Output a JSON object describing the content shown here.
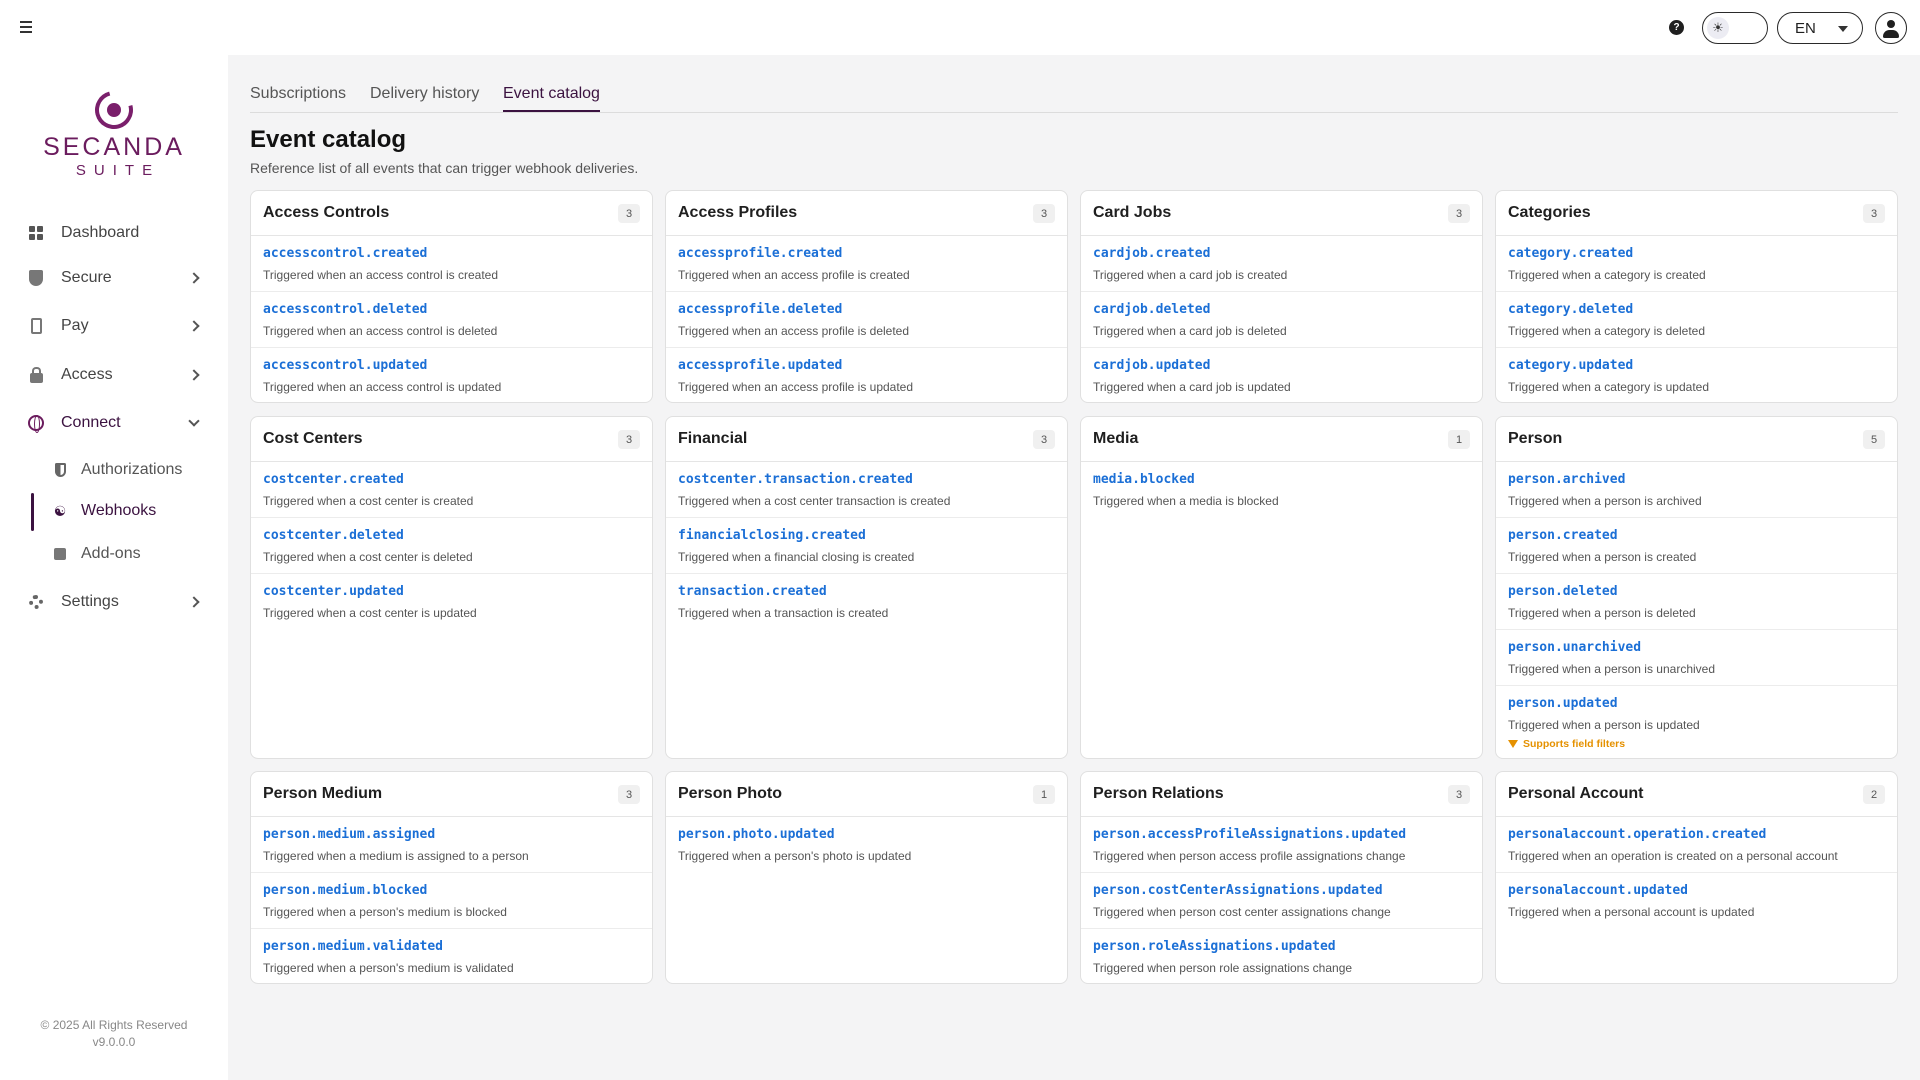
{
  "topbar": {
    "help_glyph": "?",
    "theme_glyph": "☀",
    "language": "EN"
  },
  "brand": {
    "name": "SECANDA",
    "suite": "SUITE",
    "color": "#6b1c5e"
  },
  "sidebar": {
    "items": [
      {
        "label": "Dashboard"
      },
      {
        "label": "Secure"
      },
      {
        "label": "Pay"
      },
      {
        "label": "Access"
      },
      {
        "label": "Connect"
      },
      {
        "label": "Settings"
      }
    ],
    "connect_sub": [
      {
        "label": "Authorizations"
      },
      {
        "label": "Webhooks"
      },
      {
        "label": "Add-ons"
      }
    ],
    "footer_copyright": "© 2025 All Rights Reserved",
    "footer_version": "v9.0.0.0"
  },
  "tabs": [
    {
      "label": "Subscriptions"
    },
    {
      "label": "Delivery history"
    },
    {
      "label": "Event catalog"
    }
  ],
  "page": {
    "title": "Event catalog",
    "subtitle": "Reference list of all events that can trigger webhook deliveries."
  },
  "colors": {
    "event_name": "#1b6fd6",
    "filter_note": "#e59100",
    "accent": "#3b1240"
  },
  "cards": [
    {
      "title": "Access Controls",
      "count": "3",
      "events": [
        {
          "name": "accesscontrol.created",
          "desc": "Triggered when an access control is created"
        },
        {
          "name": "accesscontrol.deleted",
          "desc": "Triggered when an access control is deleted"
        },
        {
          "name": "accesscontrol.updated",
          "desc": "Triggered when an access control is updated"
        }
      ]
    },
    {
      "title": "Access Profiles",
      "count": "3",
      "events": [
        {
          "name": "accessprofile.created",
          "desc": "Triggered when an access profile is created"
        },
        {
          "name": "accessprofile.deleted",
          "desc": "Triggered when an access profile is deleted"
        },
        {
          "name": "accessprofile.updated",
          "desc": "Triggered when an access profile is updated"
        }
      ]
    },
    {
      "title": "Card Jobs",
      "count": "3",
      "events": [
        {
          "name": "cardjob.created",
          "desc": "Triggered when a card job is created"
        },
        {
          "name": "cardjob.deleted",
          "desc": "Triggered when a card job is deleted"
        },
        {
          "name": "cardjob.updated",
          "desc": "Triggered when a card job is updated"
        }
      ]
    },
    {
      "title": "Categories",
      "count": "3",
      "events": [
        {
          "name": "category.created",
          "desc": "Triggered when a category is created"
        },
        {
          "name": "category.deleted",
          "desc": "Triggered when a category is deleted"
        },
        {
          "name": "category.updated",
          "desc": "Triggered when a category is updated"
        }
      ]
    },
    {
      "title": "Cost Centers",
      "count": "3",
      "events": [
        {
          "name": "costcenter.created",
          "desc": "Triggered when a cost center is created"
        },
        {
          "name": "costcenter.deleted",
          "desc": "Triggered when a cost center is deleted"
        },
        {
          "name": "costcenter.updated",
          "desc": "Triggered when a cost center is updated"
        }
      ]
    },
    {
      "title": "Financial",
      "count": "3",
      "events": [
        {
          "name": "costcenter.transaction.created",
          "desc": "Triggered when a cost center transaction is created"
        },
        {
          "name": "financialclosing.created",
          "desc": "Triggered when a financial closing is created"
        },
        {
          "name": "transaction.created",
          "desc": "Triggered when a transaction is created"
        }
      ]
    },
    {
      "title": "Media",
      "count": "1",
      "events": [
        {
          "name": "media.blocked",
          "desc": "Triggered when a media is blocked"
        }
      ]
    },
    {
      "title": "Person",
      "count": "5",
      "events": [
        {
          "name": "person.archived",
          "desc": "Triggered when a person is archived"
        },
        {
          "name": "person.created",
          "desc": "Triggered when a person is created"
        },
        {
          "name": "person.deleted",
          "desc": "Triggered when a person is deleted"
        },
        {
          "name": "person.unarchived",
          "desc": "Triggered when a person is unarchived"
        },
        {
          "name": "person.updated",
          "desc": "Triggered when a person is updated",
          "filter": "Supports field filters"
        }
      ]
    },
    {
      "title": "Person Medium",
      "count": "3",
      "events": [
        {
          "name": "person.medium.assigned",
          "desc": "Triggered when a medium is assigned to a person"
        },
        {
          "name": "person.medium.blocked",
          "desc": "Triggered when a person's medium is blocked"
        },
        {
          "name": "person.medium.validated",
          "desc": "Triggered when a person's medium is validated"
        }
      ]
    },
    {
      "title": "Person Photo",
      "count": "1",
      "events": [
        {
          "name": "person.photo.updated",
          "desc": "Triggered when a person's photo is updated"
        }
      ]
    },
    {
      "title": "Person Relations",
      "count": "3",
      "events": [
        {
          "name": "person.accessProfileAssignations.updated",
          "desc": "Triggered when person access profile assignations change"
        },
        {
          "name": "person.costCenterAssignations.updated",
          "desc": "Triggered when person cost center assignations change"
        },
        {
          "name": "person.roleAssignations.updated",
          "desc": "Triggered when person role assignations change"
        }
      ]
    },
    {
      "title": "Personal Account",
      "count": "2",
      "events": [
        {
          "name": "personalaccount.operation.created",
          "desc": "Triggered when an operation is created on a personal account"
        },
        {
          "name": "personalaccount.updated",
          "desc": "Triggered when a personal account is updated"
        }
      ]
    }
  ]
}
